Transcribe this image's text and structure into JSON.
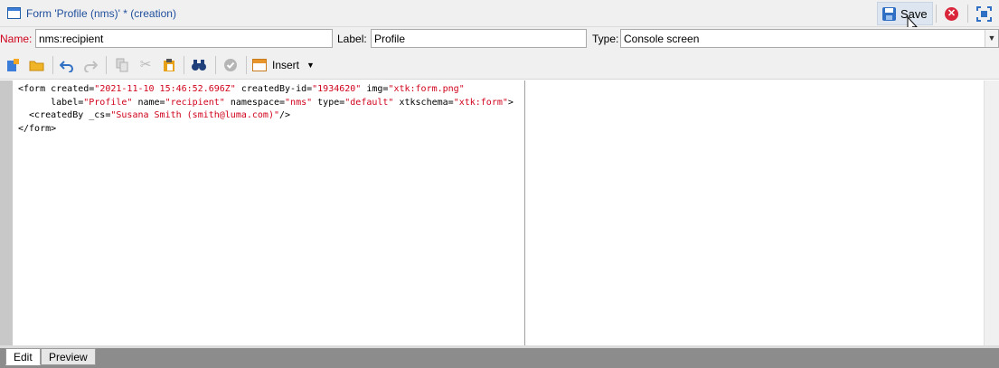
{
  "window": {
    "title": "Form 'Profile (nms)' * (creation)",
    "save_label": "Save",
    "icons": [
      "window-icon",
      "save-disk-icon",
      "close-icon",
      "maximize-icon"
    ]
  },
  "fields": {
    "name_label": "Name:",
    "name_value": "nms:recipient",
    "label_label": "Label:",
    "label_value": "Profile",
    "type_label": "Type:",
    "type_value": "Console screen"
  },
  "toolbar": {
    "insert_label": "Insert"
  },
  "editor": {
    "lines": [
      [
        [
          "<form created=",
          "a"
        ],
        [
          "\"2021-11-10 15:46:52.696Z\"",
          "v"
        ],
        [
          " createdBy-id=",
          "a"
        ],
        [
          "\"1934620\"",
          "v"
        ],
        [
          " img=",
          "a"
        ],
        [
          "\"xtk:form.png\"",
          "v"
        ]
      ],
      [
        [
          "      label=",
          "a"
        ],
        [
          "\"Profile\"",
          "v"
        ],
        [
          " name=",
          "a"
        ],
        [
          "\"recipient\"",
          "v"
        ],
        [
          " namespace=",
          "a"
        ],
        [
          "\"nms\"",
          "v"
        ],
        [
          " type=",
          "a"
        ],
        [
          "\"default\"",
          "v"
        ],
        [
          " xtkschema=",
          "a"
        ],
        [
          "\"xtk:form\"",
          "v"
        ],
        [
          ">",
          "a"
        ]
      ],
      [
        [
          "  <createdBy _cs=",
          "a"
        ],
        [
          "\"Susana Smith (smith@luma.com)\"",
          "v"
        ],
        [
          "/>",
          "a"
        ]
      ],
      [
        [
          "</form>",
          "a"
        ]
      ]
    ]
  },
  "tabs": {
    "edit": "Edit",
    "preview": "Preview"
  },
  "colors": {
    "attr_value": "#d0021b",
    "required_label": "#d0021b",
    "title_text": "#1f4e9c"
  }
}
